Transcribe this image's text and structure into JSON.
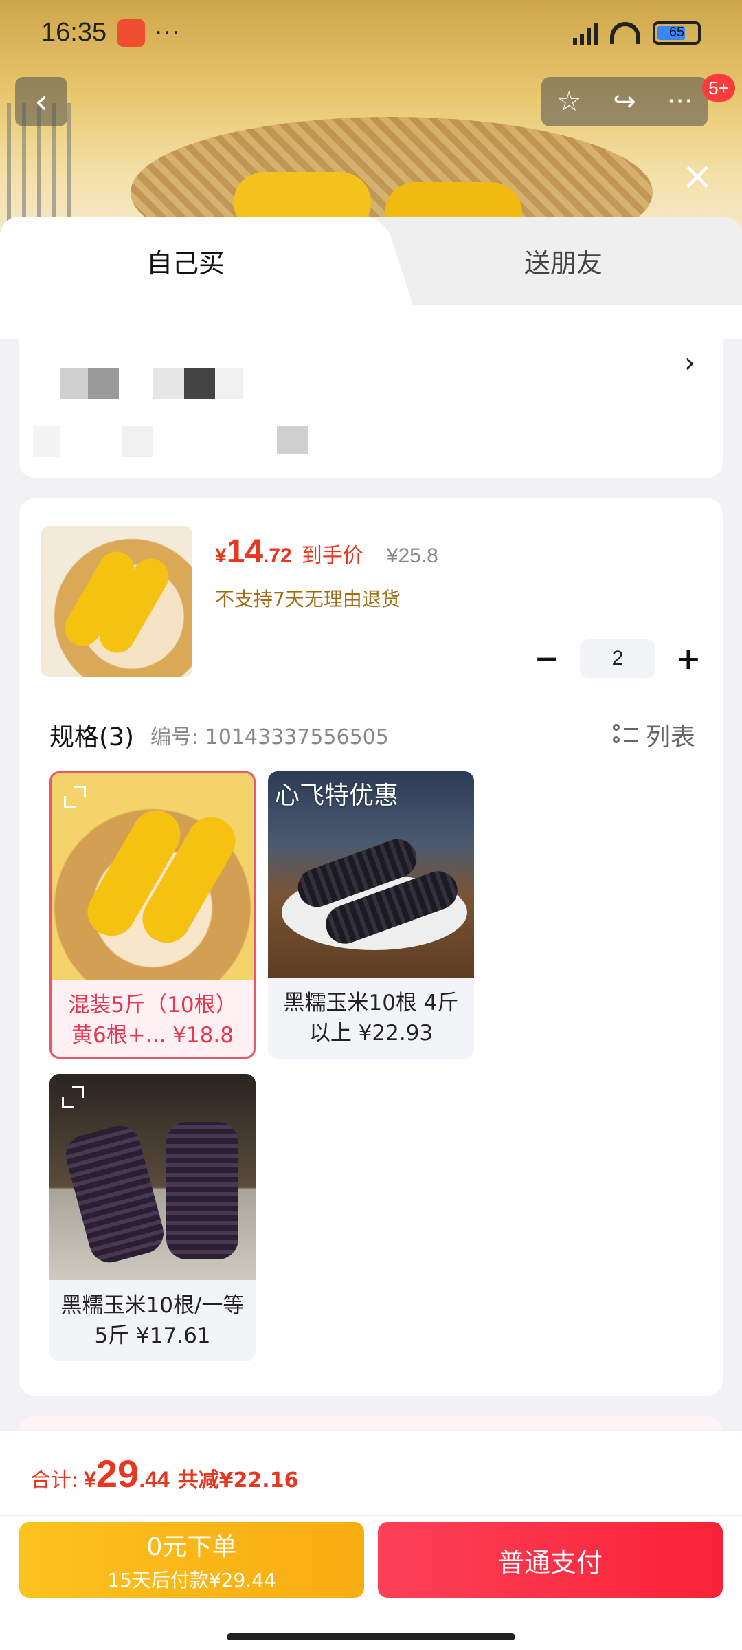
{
  "status_bar": {
    "time": "16:35",
    "more": "···",
    "battery": "65"
  },
  "nav": {
    "back": "‹",
    "favorite": "☆",
    "share": "↪",
    "more": "···",
    "badge": "5+",
    "close": "×"
  },
  "tabs": {
    "self_buy": "自己买",
    "gift_friend": "送朋友"
  },
  "address": {
    "chevron": "›"
  },
  "product": {
    "price_symbol": "¥",
    "price_int": "14",
    "price_dec": ".72",
    "price_label": "到手价",
    "original_price": "¥25.8",
    "return_note": "不支持7天无理由退货",
    "qty_minus": "−",
    "quantity": "2",
    "qty_plus": "+"
  },
  "spec": {
    "title": "规格(3)",
    "code": "编号: 10143337556505",
    "list_label": "列表",
    "options": [
      {
        "caption": "混装5斤（10根）黄6根+... ¥18.8",
        "selected": true
      },
      {
        "caption": "黑糯玉米10根 4斤以上 ¥22.93",
        "promo": "心飞特优惠",
        "selected": false
      },
      {
        "caption": "黑糯玉米10根/一等 5斤 ¥17.61",
        "selected": false
      }
    ]
  },
  "footer": {
    "total_label": "合计:",
    "total_symbol": "¥",
    "total_int": "29",
    "total_dec": ".44",
    "discount": "共减¥22.16",
    "pay_later_title": "0元下单",
    "pay_later_sub": "15天后付款¥29.44",
    "pay_normal": "普通支付"
  }
}
